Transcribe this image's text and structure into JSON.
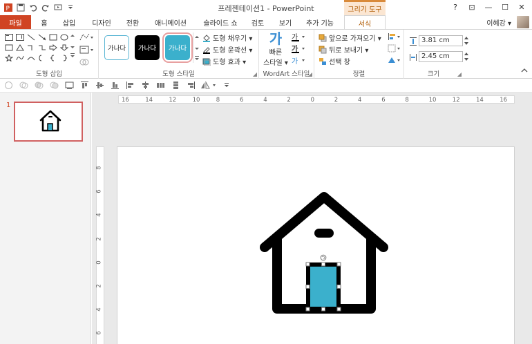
{
  "window": {
    "title": "프레젠테이션1 - PowerPoint",
    "context_tab": "그리기 도구"
  },
  "window_controls": {
    "help": "?",
    "restore": "⊡",
    "minimize": "—",
    "maximize": "☐",
    "close": "✕"
  },
  "tabs": [
    {
      "label": "파일"
    },
    {
      "label": "홈"
    },
    {
      "label": "삽입"
    },
    {
      "label": "디자인"
    },
    {
      "label": "전환"
    },
    {
      "label": "애니메이션"
    },
    {
      "label": "슬라이드 쇼"
    },
    {
      "label": "검토"
    },
    {
      "label": "보기"
    },
    {
      "label": "추가 기능"
    },
    {
      "label": "서식"
    }
  ],
  "user": {
    "name": "이혜강 ▾"
  },
  "ribbon": {
    "groups": {
      "insert_shapes": "도형 삽입",
      "shape_styles": "도형 스타일",
      "wordart_styles": "WordArt 스타일",
      "arrange": "정렬",
      "size": "크기"
    },
    "style_sample_text": "가나다",
    "shape_fill": "도형 채우기 ▾",
    "shape_outline": "도형 윤곽선 ▾",
    "shape_effects": "도형 효과 ▾",
    "quick_styles_line1": "빠른",
    "quick_styles_line2": "스타일 ▾",
    "bring_forward": "앞으로 가져오기 ▾",
    "send_backward": "뒤로 보내기 ▾",
    "selection_pane": "선택 창",
    "height": "3.81 cm",
    "width": "2.45 cm"
  },
  "slide_panel": {
    "slide_number": "1"
  },
  "ruler": {
    "horizontal": [
      "16",
      "14",
      "12",
      "10",
      "8",
      "6",
      "4",
      "2",
      "0",
      "2",
      "4",
      "6",
      "8",
      "10",
      "12",
      "14",
      "16"
    ],
    "vertical": [
      "8",
      "6",
      "4",
      "2",
      "0",
      "2",
      "4",
      "6"
    ]
  },
  "colors": {
    "accent": "#d04423",
    "door": "#3bb0cc",
    "house": "#000000",
    "context": "#b05a00"
  }
}
